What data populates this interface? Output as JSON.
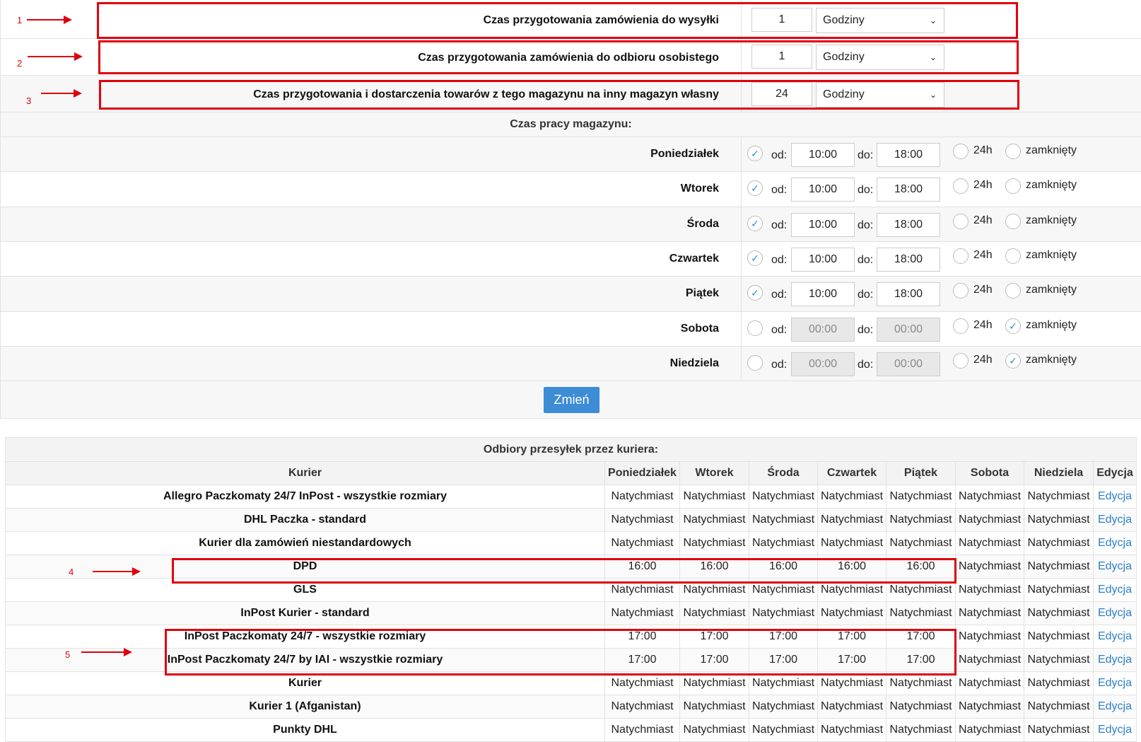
{
  "annotations": [
    "1",
    "2",
    "3",
    "4",
    "5"
  ],
  "prep": [
    {
      "label": "Czas przygotowania zamówienia do wysyłki",
      "value": "1",
      "unit": "Godziny"
    },
    {
      "label": "Czas przygotowania zamówienia do odbioru osobistego",
      "value": "1",
      "unit": "Godziny"
    },
    {
      "label": "Czas przygotowania i dostarczenia towarów z tego magazynu na inny magazyn własny",
      "value": "24",
      "unit": "Godziny"
    }
  ],
  "hours_title": "Czas pracy magazynu:",
  "od_label": "od:",
  "do_label": "do:",
  "h24_label": "24h",
  "closed_label": "zamknięty",
  "check_glyph": "✓",
  "days": [
    {
      "name": "Poniedziałek",
      "from": "10:00",
      "to": "18:00",
      "open": true,
      "closed": false
    },
    {
      "name": "Wtorek",
      "from": "10:00",
      "to": "18:00",
      "open": true,
      "closed": false
    },
    {
      "name": "Środa",
      "from": "10:00",
      "to": "18:00",
      "open": true,
      "closed": false
    },
    {
      "name": "Czwartek",
      "from": "10:00",
      "to": "18:00",
      "open": true,
      "closed": false
    },
    {
      "name": "Piątek",
      "from": "10:00",
      "to": "18:00",
      "open": true,
      "closed": false
    },
    {
      "name": "Sobota",
      "from": "00:00",
      "to": "00:00",
      "open": false,
      "closed": true
    },
    {
      "name": "Niedziela",
      "from": "00:00",
      "to": "00:00",
      "open": false,
      "closed": true
    }
  ],
  "change_button": "Zmień",
  "couriers_title": "Odbiory przesyłek przez kuriera:",
  "columns": [
    "Kurier",
    "Poniedziałek",
    "Wtorek",
    "Środa",
    "Czwartek",
    "Piątek",
    "Sobota",
    "Niedziela",
    "Edycja"
  ],
  "edit_link": "Edycja",
  "couriers": [
    {
      "name": "Allegro Paczkomaty 24/7 InPost - wszystkie rozmiary",
      "times": [
        "Natychmiast",
        "Natychmiast",
        "Natychmiast",
        "Natychmiast",
        "Natychmiast",
        "Natychmiast",
        "Natychmiast"
      ]
    },
    {
      "name": "DHL Paczka - standard",
      "times": [
        "Natychmiast",
        "Natychmiast",
        "Natychmiast",
        "Natychmiast",
        "Natychmiast",
        "Natychmiast",
        "Natychmiast"
      ]
    },
    {
      "name": "Kurier dla zamówień niestandardowych",
      "times": [
        "Natychmiast",
        "Natychmiast",
        "Natychmiast",
        "Natychmiast",
        "Natychmiast",
        "Natychmiast",
        "Natychmiast"
      ]
    },
    {
      "name": "DPD",
      "times": [
        "16:00",
        "16:00",
        "16:00",
        "16:00",
        "16:00",
        "Natychmiast",
        "Natychmiast"
      ]
    },
    {
      "name": "GLS",
      "times": [
        "Natychmiast",
        "Natychmiast",
        "Natychmiast",
        "Natychmiast",
        "Natychmiast",
        "Natychmiast",
        "Natychmiast"
      ]
    },
    {
      "name": "InPost Kurier - standard",
      "times": [
        "Natychmiast",
        "Natychmiast",
        "Natychmiast",
        "Natychmiast",
        "Natychmiast",
        "Natychmiast",
        "Natychmiast"
      ]
    },
    {
      "name": "InPost Paczkomaty 24/7 - wszystkie rozmiary",
      "times": [
        "17:00",
        "17:00",
        "17:00",
        "17:00",
        "17:00",
        "Natychmiast",
        "Natychmiast"
      ]
    },
    {
      "name": "InPost Paczkomaty 24/7 by IAI - wszystkie rozmiary",
      "times": [
        "17:00",
        "17:00",
        "17:00",
        "17:00",
        "17:00",
        "Natychmiast",
        "Natychmiast"
      ]
    },
    {
      "name": "Kurier",
      "times": [
        "Natychmiast",
        "Natychmiast",
        "Natychmiast",
        "Natychmiast",
        "Natychmiast",
        "Natychmiast",
        "Natychmiast"
      ]
    },
    {
      "name": "Kurier 1 (Afganistan)",
      "times": [
        "Natychmiast",
        "Natychmiast",
        "Natychmiast",
        "Natychmiast",
        "Natychmiast",
        "Natychmiast",
        "Natychmiast"
      ]
    },
    {
      "name": "Punkty DHL",
      "times": [
        "Natychmiast",
        "Natychmiast",
        "Natychmiast",
        "Natychmiast",
        "Natychmiast",
        "Natychmiast",
        "Natychmiast"
      ]
    }
  ]
}
